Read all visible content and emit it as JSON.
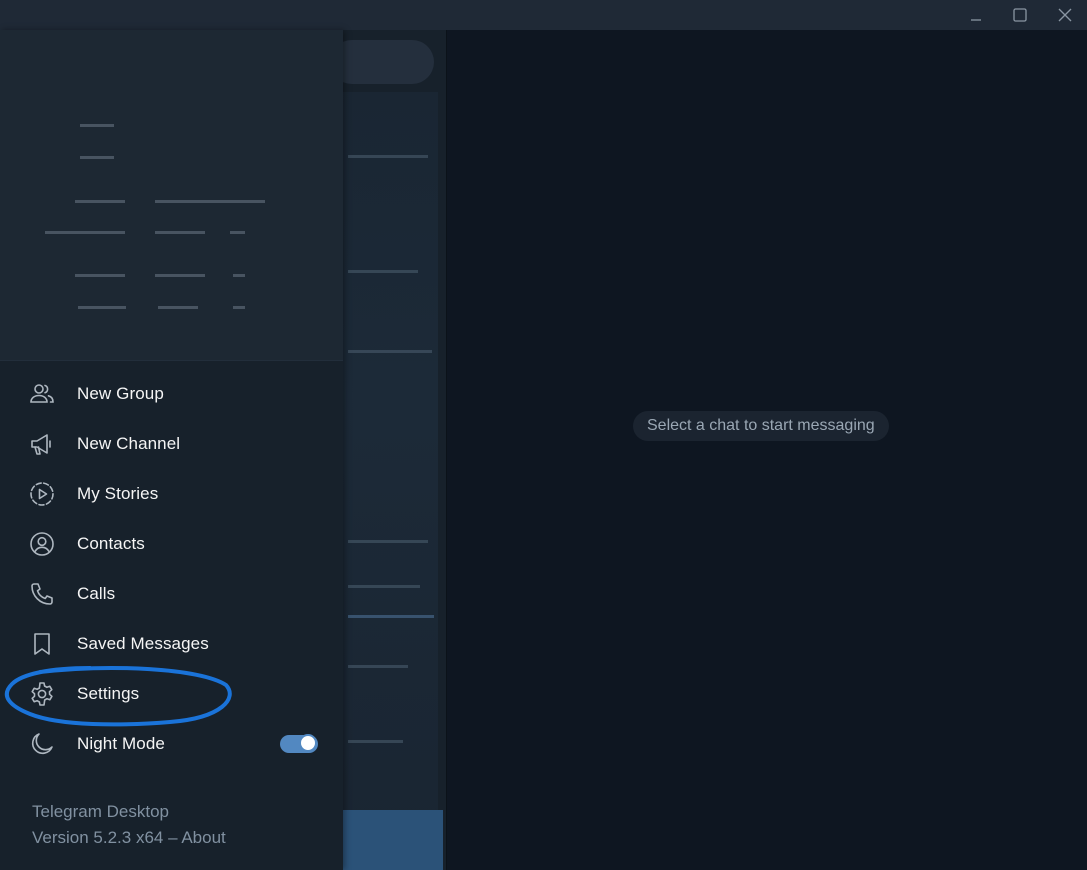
{
  "window": {
    "controls": [
      "minimize-icon",
      "maximize-icon",
      "close-icon"
    ]
  },
  "menu": {
    "items": [
      {
        "id": "new-group",
        "label": "New Group",
        "icon": "people-icon"
      },
      {
        "id": "new-channel",
        "label": "New Channel",
        "icon": "megaphone-icon"
      },
      {
        "id": "my-stories",
        "label": "My Stories",
        "icon": "stories-icon"
      },
      {
        "id": "contacts",
        "label": "Contacts",
        "icon": "contact-icon"
      },
      {
        "id": "calls",
        "label": "Calls",
        "icon": "phone-icon"
      },
      {
        "id": "saved-messages",
        "label": "Saved Messages",
        "icon": "bookmark-icon"
      },
      {
        "id": "settings",
        "label": "Settings",
        "icon": "gear-icon"
      },
      {
        "id": "night-mode",
        "label": "Night Mode",
        "icon": "moon-icon",
        "toggle_on": true
      }
    ]
  },
  "footer": {
    "app_name": "Telegram Desktop",
    "version": "Version 5.2.3 x64 – About"
  },
  "main": {
    "empty_state": "Select a chat to start messaging"
  },
  "colors": {
    "accent": "#5288c1",
    "annotation": "#1a73d9",
    "background": "#0e1621",
    "sidebar": "#17212b"
  }
}
